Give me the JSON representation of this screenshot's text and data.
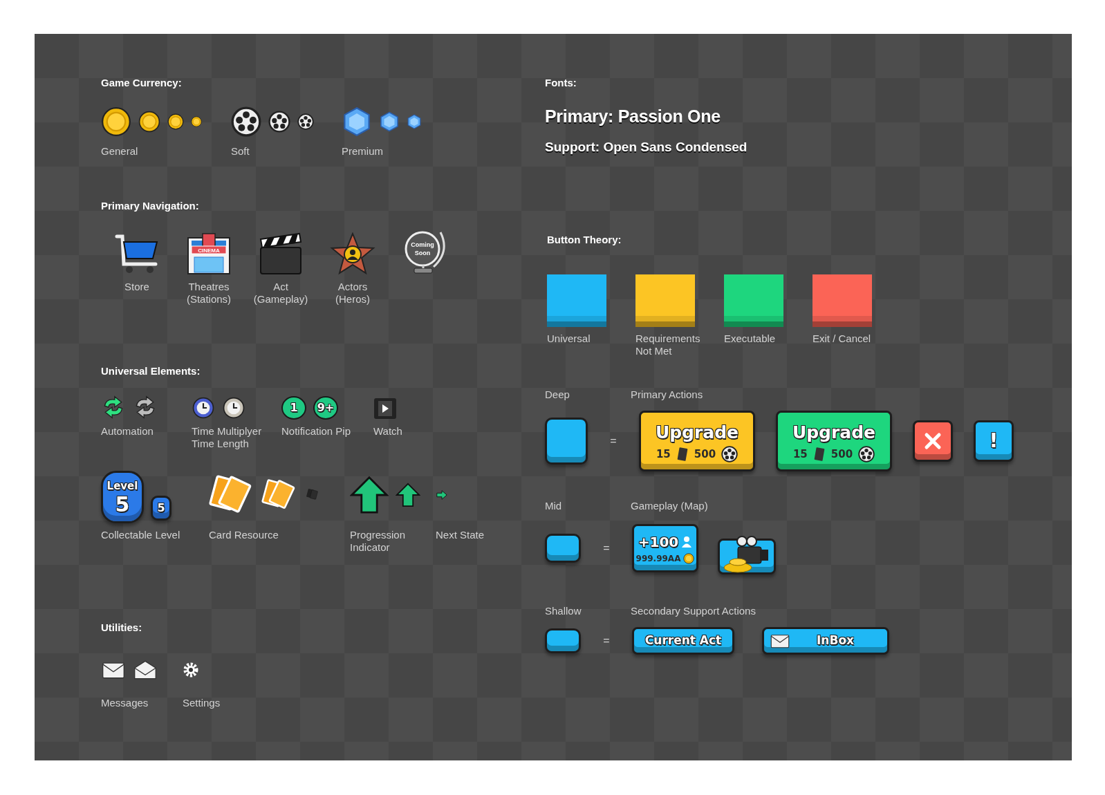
{
  "game_currency": {
    "heading": "Game Currency:",
    "groups": [
      {
        "kind": "coin",
        "label": "General"
      },
      {
        "kind": "reel",
        "label": "Soft"
      },
      {
        "kind": "gem",
        "label": "Premium"
      }
    ]
  },
  "primary_navigation": {
    "heading": "Primary Navigation:",
    "items": [
      {
        "kind": "cart",
        "lines": [
          "Store"
        ]
      },
      {
        "kind": "cinema",
        "sign": "CINEMA",
        "lines": [
          "Theatres",
          "(Stations)"
        ]
      },
      {
        "kind": "clapper",
        "lines": [
          "Act",
          "(Gameplay)"
        ]
      },
      {
        "kind": "star",
        "lines": [
          "Actors",
          "(Heros)"
        ]
      },
      {
        "kind": "globe",
        "sign_lines": [
          "Coming",
          "Soon"
        ]
      }
    ]
  },
  "universal_elements": {
    "heading": "Universal Elements:",
    "row_1": [
      {
        "kind": "automation",
        "lines": [
          "Automation"
        ]
      },
      {
        "kind": "time",
        "lines": [
          "Time Multiplyer",
          "Time Length"
        ]
      },
      {
        "kind": "pip",
        "pips": [
          "1",
          "9+"
        ],
        "lines": [
          "Notification Pip"
        ]
      },
      {
        "kind": "watch",
        "lines": [
          "Watch"
        ]
      }
    ],
    "row_2": [
      {
        "kind": "level",
        "badge_caption": "Level",
        "badge_number": "5",
        "small_number": "5",
        "lines": [
          "Collectable Level"
        ]
      },
      {
        "kind": "cards",
        "lines": [
          "Card Resource"
        ]
      },
      {
        "kind": "progress",
        "lines": [
          "Progression",
          "Indicator"
        ]
      },
      {
        "kind": "next",
        "lines": [
          "Next State"
        ]
      }
    ]
  },
  "utilities": {
    "heading": "Utilities:",
    "items": [
      {
        "kind": "messages",
        "lines": [
          "Messages"
        ]
      },
      {
        "kind": "settings",
        "lines": [
          "Settings"
        ]
      }
    ]
  },
  "fonts": {
    "heading": "Fonts:",
    "primary": "Primary: Passion One",
    "support": "Support: Open Sans Condensed"
  },
  "button_theory": {
    "heading": "Button Theory:",
    "swatches": [
      {
        "color": "#1fb8f5",
        "lines": [
          "Universal"
        ]
      },
      {
        "color": "#fcc524",
        "lines": [
          "Requirements",
          "Not Met"
        ]
      },
      {
        "color": "#1ed67e",
        "lines": [
          "Executable"
        ]
      },
      {
        "color": "#fb6456",
        "lines": [
          "Exit / Cancel"
        ]
      }
    ]
  },
  "depths": [
    {
      "label": "Deep",
      "category": "Primary Actions",
      "equals": "=",
      "buttons": [
        {
          "kind": "upgrade",
          "color": "#fcc524",
          "title": "Upgrade",
          "count": "15",
          "cost": "500"
        },
        {
          "kind": "upgrade",
          "color": "#1ed67e",
          "title": "Upgrade",
          "count": "15",
          "cost": "500"
        },
        {
          "kind": "close",
          "color": "#fb6456"
        },
        {
          "kind": "alert",
          "color": "#1fb8f5",
          "text": "!"
        }
      ]
    },
    {
      "label": "Mid",
      "category": "Gameplay (Map)",
      "equals": "=",
      "buttons": [
        {
          "kind": "reward",
          "color": "#1fb8f5",
          "amount": "+100",
          "cost": "999.99AA"
        },
        {
          "kind": "treasure",
          "color": "#1fb8f5"
        }
      ]
    },
    {
      "label": "Shallow",
      "category": "Secondary Support Actions",
      "equals": "=",
      "buttons": [
        {
          "kind": "text",
          "color": "#1fb8f5",
          "text": "Current Act"
        },
        {
          "kind": "mail",
          "color": "#1fb8f5",
          "text": "InBox"
        }
      ]
    }
  ]
}
